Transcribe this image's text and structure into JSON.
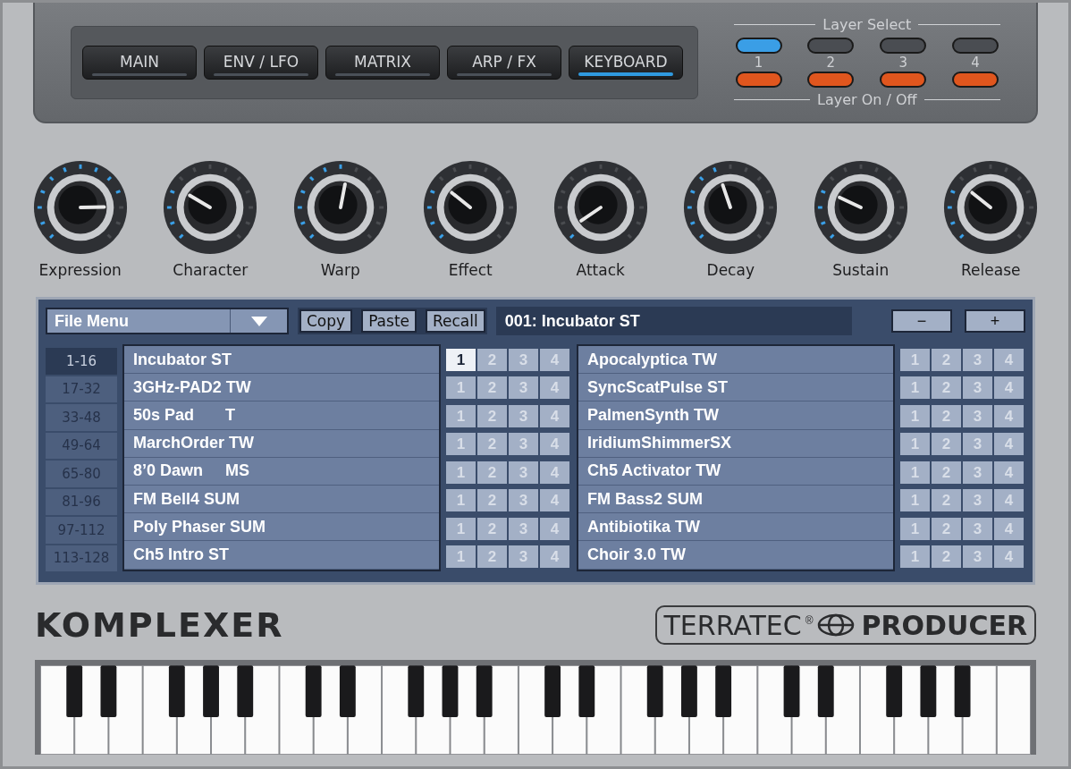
{
  "tabs": [
    {
      "label": "MAIN",
      "selected": false
    },
    {
      "label": "ENV / LFO",
      "selected": false
    },
    {
      "label": "MATRIX",
      "selected": false
    },
    {
      "label": "ARP / FX",
      "selected": false
    },
    {
      "label": "KEYBOARD",
      "selected": true
    }
  ],
  "layer_select": {
    "title": "Layer Select",
    "layers": [
      {
        "label": "1",
        "selected": true
      },
      {
        "label": "2",
        "selected": false
      },
      {
        "label": "3",
        "selected": false
      },
      {
        "label": "4",
        "selected": false
      }
    ]
  },
  "layer_on_off": {
    "title": "Layer On / Off",
    "layers": [
      {
        "on": true
      },
      {
        "on": true
      },
      {
        "on": true
      },
      {
        "on": true
      }
    ]
  },
  "knobs": [
    {
      "label": "Expression"
    },
    {
      "label": "Character"
    },
    {
      "label": "Warp"
    },
    {
      "label": "Effect"
    },
    {
      "label": "Attack"
    },
    {
      "label": "Decay"
    },
    {
      "label": "Sustain"
    },
    {
      "label": "Release"
    }
  ],
  "browser": {
    "file_menu": "File Menu",
    "buttons": [
      "Copy",
      "Paste",
      "Recall"
    ],
    "current_preset": "001: Incubator ST",
    "nav_buttons": [
      "−",
      "+"
    ],
    "banks": [
      {
        "label": "1-16",
        "selected": true
      },
      {
        "label": "17-32",
        "selected": false
      },
      {
        "label": "33-48",
        "selected": false
      },
      {
        "label": "49-64",
        "selected": false
      },
      {
        "label": "65-80",
        "selected": false
      },
      {
        "label": "81-96",
        "selected": false
      },
      {
        "label": "97-112",
        "selected": false
      },
      {
        "label": "113-128",
        "selected": false
      }
    ],
    "columns": [
      {
        "presets": [
          {
            "name": "Incubator ST",
            "slots": [
              {
                "label": "1",
                "on": true
              },
              {
                "label": "2",
                "on": false
              },
              {
                "label": "3",
                "on": false
              },
              {
                "label": "4",
                "on": false
              }
            ]
          },
          {
            "name": "3GHz-PAD2 TW",
            "slots": [
              {
                "label": "1",
                "on": false
              },
              {
                "label": "2",
                "on": false
              },
              {
                "label": "3",
                "on": false
              },
              {
                "label": "4",
                "on": false
              }
            ]
          },
          {
            "name": "50s Pad       T",
            "slots": [
              {
                "label": "1",
                "on": false
              },
              {
                "label": "2",
                "on": false
              },
              {
                "label": "3",
                "on": false
              },
              {
                "label": "4",
                "on": false
              }
            ]
          },
          {
            "name": "MarchOrder TW",
            "slots": [
              {
                "label": "1",
                "on": false
              },
              {
                "label": "2",
                "on": false
              },
              {
                "label": "3",
                "on": false
              },
              {
                "label": "4",
                "on": false
              }
            ]
          },
          {
            "name": "8’0 Dawn     MS",
            "slots": [
              {
                "label": "1",
                "on": false
              },
              {
                "label": "2",
                "on": false
              },
              {
                "label": "3",
                "on": false
              },
              {
                "label": "4",
                "on": false
              }
            ]
          },
          {
            "name": "FM Bell4 SUM",
            "slots": [
              {
                "label": "1",
                "on": false
              },
              {
                "label": "2",
                "on": false
              },
              {
                "label": "3",
                "on": false
              },
              {
                "label": "4",
                "on": false
              }
            ]
          },
          {
            "name": "Poly Phaser SUM",
            "slots": [
              {
                "label": "1",
                "on": false
              },
              {
                "label": "2",
                "on": false
              },
              {
                "label": "3",
                "on": false
              },
              {
                "label": "4",
                "on": false
              }
            ]
          },
          {
            "name": "Ch5 Intro ST",
            "slots": [
              {
                "label": "1",
                "on": false
              },
              {
                "label": "2",
                "on": false
              },
              {
                "label": "3",
                "on": false
              },
              {
                "label": "4",
                "on": false
              }
            ]
          }
        ]
      },
      {
        "presets": [
          {
            "name": "Apocalyptica TW",
            "slots": [
              {
                "label": "1",
                "on": false
              },
              {
                "label": "2",
                "on": false
              },
              {
                "label": "3",
                "on": false
              },
              {
                "label": "4",
                "on": false
              }
            ]
          },
          {
            "name": "SyncScatPulse ST",
            "slots": [
              {
                "label": "1",
                "on": false
              },
              {
                "label": "2",
                "on": false
              },
              {
                "label": "3",
                "on": false
              },
              {
                "label": "4",
                "on": false
              }
            ]
          },
          {
            "name": "PalmenSynth TW",
            "slots": [
              {
                "label": "1",
                "on": false
              },
              {
                "label": "2",
                "on": false
              },
              {
                "label": "3",
                "on": false
              },
              {
                "label": "4",
                "on": false
              }
            ]
          },
          {
            "name": "IridiumShimmerSX",
            "slots": [
              {
                "label": "1",
                "on": false
              },
              {
                "label": "2",
                "on": false
              },
              {
                "label": "3",
                "on": false
              },
              {
                "label": "4",
                "on": false
              }
            ]
          },
          {
            "name": "Ch5 Activator TW",
            "slots": [
              {
                "label": "1",
                "on": false
              },
              {
                "label": "2",
                "on": false
              },
              {
                "label": "3",
                "on": false
              },
              {
                "label": "4",
                "on": false
              }
            ]
          },
          {
            "name": "FM Bass2 SUM",
            "slots": [
              {
                "label": "1",
                "on": false
              },
              {
                "label": "2",
                "on": false
              },
              {
                "label": "3",
                "on": false
              },
              {
                "label": "4",
                "on": false
              }
            ]
          },
          {
            "name": "Antibiotika TW",
            "slots": [
              {
                "label": "1",
                "on": false
              },
              {
                "label": "2",
                "on": false
              },
              {
                "label": "3",
                "on": false
              },
              {
                "label": "4",
                "on": false
              }
            ]
          },
          {
            "name": "Choir 3.0 TW",
            "slots": [
              {
                "label": "1",
                "on": false
              },
              {
                "label": "2",
                "on": false
              },
              {
                "label": "3",
                "on": false
              },
              {
                "label": "4",
                "on": false
              }
            ]
          }
        ]
      }
    ]
  },
  "product_name": "KOMPLEXER",
  "brand": {
    "left": "TERRATEC",
    "mark": "®",
    "right": "PRODUCER"
  }
}
